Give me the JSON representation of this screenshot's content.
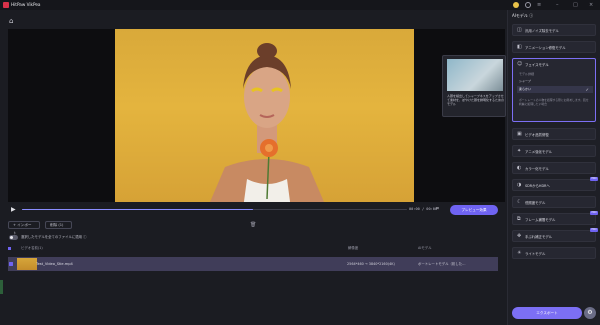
{
  "app": {
    "title": "HitPaw VikPea"
  },
  "controls": {
    "timecode": "00:00 / 00:00",
    "preview_label": "プレビュー効果",
    "progress": 0.6
  },
  "list_toolbar": {
    "import_label": "+ インポート",
    "delete_label": "削除 (1)"
  },
  "option": {
    "label": "選択したモデルを全てのファイルに適用 ⓘ"
  },
  "file_table": {
    "header_name": "ビデオ名前(1)",
    "header_resolution": "解像度",
    "header_model": "AIモデル",
    "row": {
      "name": "Test_Video_Stie.mp4",
      "resolution": "2564*460 → 3840*2160(4K)",
      "model": "ポートレートモデル（彩した…"
    }
  },
  "popover": {
    "description": "人顔を検出してシャープネスをアップさせて素材を、ぼやけた顔を鮮明化するためのモデル"
  },
  "panel": {
    "title": "AIモデル ⓘ",
    "models_top": [
      {
        "label": "汎用ノイズ除去モデル",
        "icon": "denoise-icon"
      },
      {
        "label": "アニメーション修復モデル",
        "icon": "animation-icon"
      }
    ],
    "selected": {
      "label": "フェイスモデル",
      "section": "モデル詳細",
      "option_1": "シャープ",
      "option_2": "柔らかい",
      "note": "ポートレートの人物を処理する際にお薦めします。肌を綺麗に処理したい場合"
    },
    "models_bottom": [
      {
        "label": "ビデオ品質修復",
        "icon": "video-quality-icon",
        "pro": false
      },
      {
        "label": "アニメ強化モデル",
        "icon": "anime-icon",
        "pro": false
      },
      {
        "label": "カラー化モデル",
        "icon": "colorize-icon",
        "pro": false
      },
      {
        "label": "SDRからHDRへ",
        "icon": "sdr-hdr-icon",
        "pro": true
      },
      {
        "label": "低照度モデル",
        "icon": "low-light-icon",
        "pro": false
      },
      {
        "label": "フレーム補間モデル",
        "icon": "frame-interp-icon",
        "pro": true
      },
      {
        "label": "手ぶれ補正モデル",
        "icon": "stabilize-icon",
        "pro": true
      },
      {
        "label": "ライトモデル",
        "icon": "light-icon",
        "pro": false
      }
    ],
    "pro_badge": "PRO",
    "export_label": "エクスポート"
  }
}
